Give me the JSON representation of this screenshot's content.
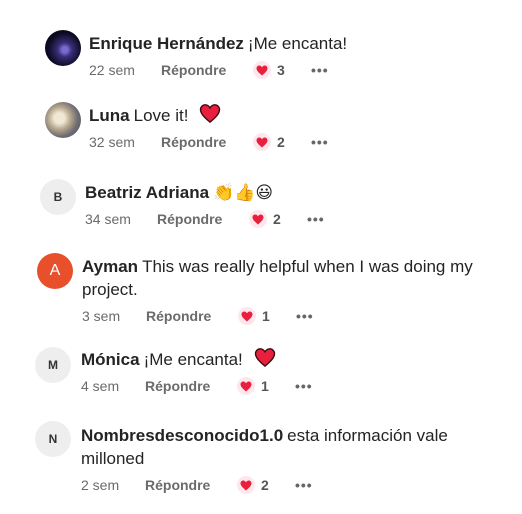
{
  "comments": [
    {
      "author": "Enrique Hernández",
      "text": "¡Me encanta!",
      "time": "22 sem",
      "reply": "Répondre",
      "reactions": "3",
      "more": "•••",
      "avatar": "photo"
    },
    {
      "author": "Luna",
      "text": "Love it!",
      "time": "32 sem",
      "reply": "Répondre",
      "reactions": "2",
      "more": "•••",
      "avatar": "photo",
      "emoji": "heart"
    },
    {
      "author": "Beatriz Adriana",
      "text": "",
      "time": "34 sem",
      "reply": "Répondre",
      "reactions": "2",
      "more": "•••",
      "avatar_letter": "B",
      "emojis": "👏👍😃"
    },
    {
      "author": "Ayman",
      "text_line1": "This was really helpful when I was doing my",
      "text_line2": "project.",
      "time": "3 sem",
      "reply": "Répondre",
      "reactions": "1",
      "more": "•••",
      "avatar_letter": "A"
    },
    {
      "author": "Mónica",
      "text": "¡Me encanta!",
      "time": "4 sem",
      "reply": "Répondre",
      "reactions": "1",
      "more": "•••",
      "avatar_letter": "M",
      "emoji": "heart"
    },
    {
      "author": "Nombresdesconocido1.0",
      "text_line1": "esta información vale",
      "text_line2": "milloned",
      "time": "2 sem",
      "reply": "Répondre",
      "reactions": "2",
      "more": "•••",
      "avatar_letter": "N"
    }
  ],
  "colors": {
    "heart": "#e8203e",
    "reaction_bg": "#fde7ec",
    "avatar_orange": "#e8502c",
    "avatar_gray": "#eeeeee"
  }
}
